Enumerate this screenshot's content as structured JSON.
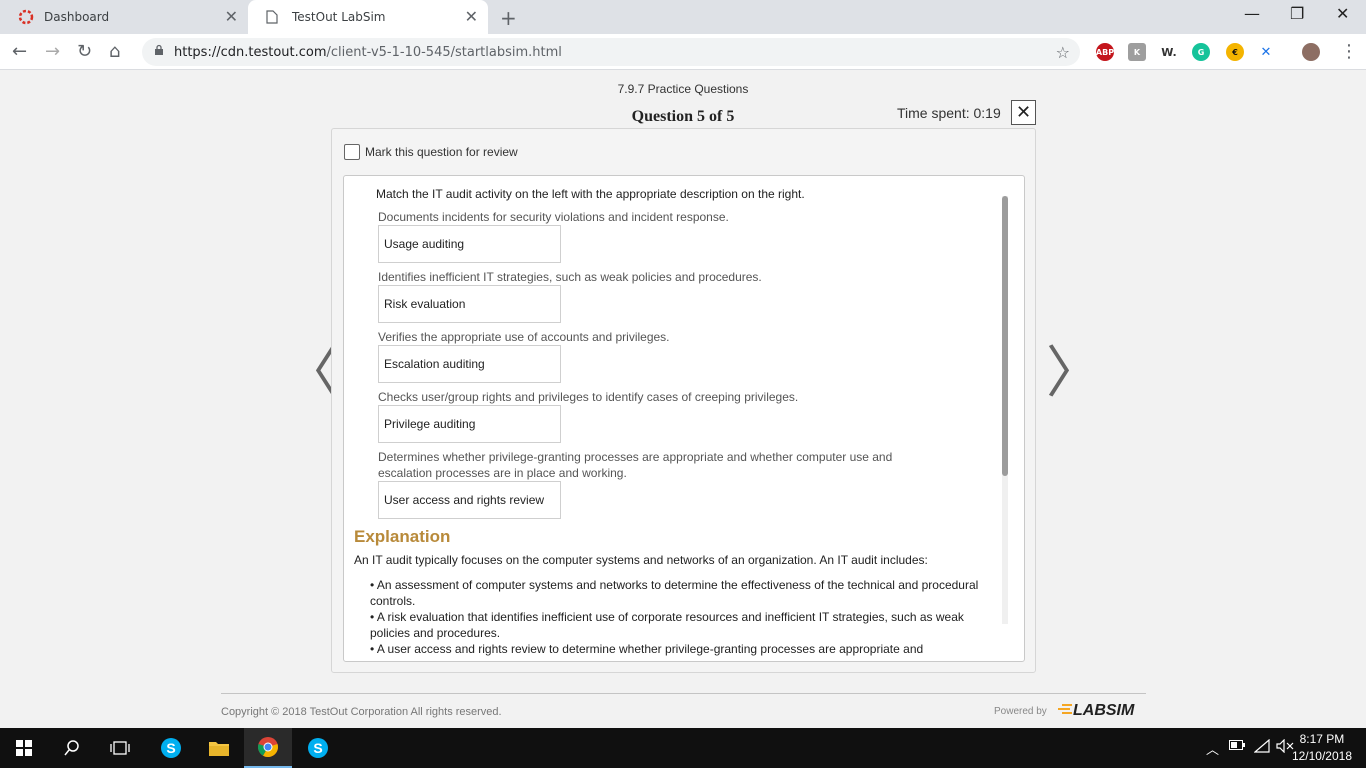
{
  "browser": {
    "tabs": [
      {
        "label": "Dashboard",
        "icon": "testout-logo-icon"
      },
      {
        "label": "TestOut LabSim",
        "icon": "page-icon",
        "active": true
      }
    ],
    "url_host": "https://cdn.testout.com",
    "url_path": "/client-v5-1-10-545/startlabsim.html",
    "extensions": [
      "ABP",
      "W."
    ]
  },
  "quiz": {
    "subtitle": "7.9.7 Practice Questions",
    "title": "Question 5 of 5",
    "time_label": "Time spent: 0:19",
    "close_symbol": "✕",
    "review_label": "Mark this question for review",
    "prompt": "Match the IT audit activity on the left with the appropriate description on the right.",
    "items": [
      {
        "description": "Documents incidents for security violations and incident response.",
        "answer": "Usage auditing"
      },
      {
        "description": "Identifies inefficient IT strategies, such as weak policies and procedures.",
        "answer": "Risk evaluation"
      },
      {
        "description": "Verifies the appropriate use of accounts and privileges.",
        "answer": "Escalation auditing"
      },
      {
        "description": "Checks user/group rights and privileges to identify cases of creeping privileges.",
        "answer": "Privilege auditing"
      },
      {
        "description": "Determines whether privilege-granting processes are appropriate and whether computer use and escalation processes are in place and working.",
        "answer": "User access and rights review"
      }
    ],
    "explanation_heading": "Explanation",
    "explanation_intro": "An IT audit typically focuses on the computer systems and networks of an organization. An IT audit includes:",
    "explanation_bullets": [
      "• An assessment of computer systems and networks to determine the effectiveness of the technical and procedural controls.",
      "• A risk evaluation that identifies inefficient use of corporate resources and inefficient IT strategies, such as weak policies and procedures.",
      "• A user access and rights review to determine whether privilege-granting processes are appropriate and"
    ],
    "prev_symbol": "〈",
    "next_symbol": "〉"
  },
  "footer": {
    "copyright": "Copyright © 2018 TestOut Corporation All rights reserved.",
    "powered_by": "Powered by",
    "logo_text": "LABSIM"
  },
  "taskbar": {
    "time": "8:17 PM",
    "date": "12/10/2018"
  },
  "colors": {
    "explanation_heading": "#b88a3a",
    "taskbar": "#101010",
    "skype": "#00aff0",
    "abp": "#c4161c"
  }
}
